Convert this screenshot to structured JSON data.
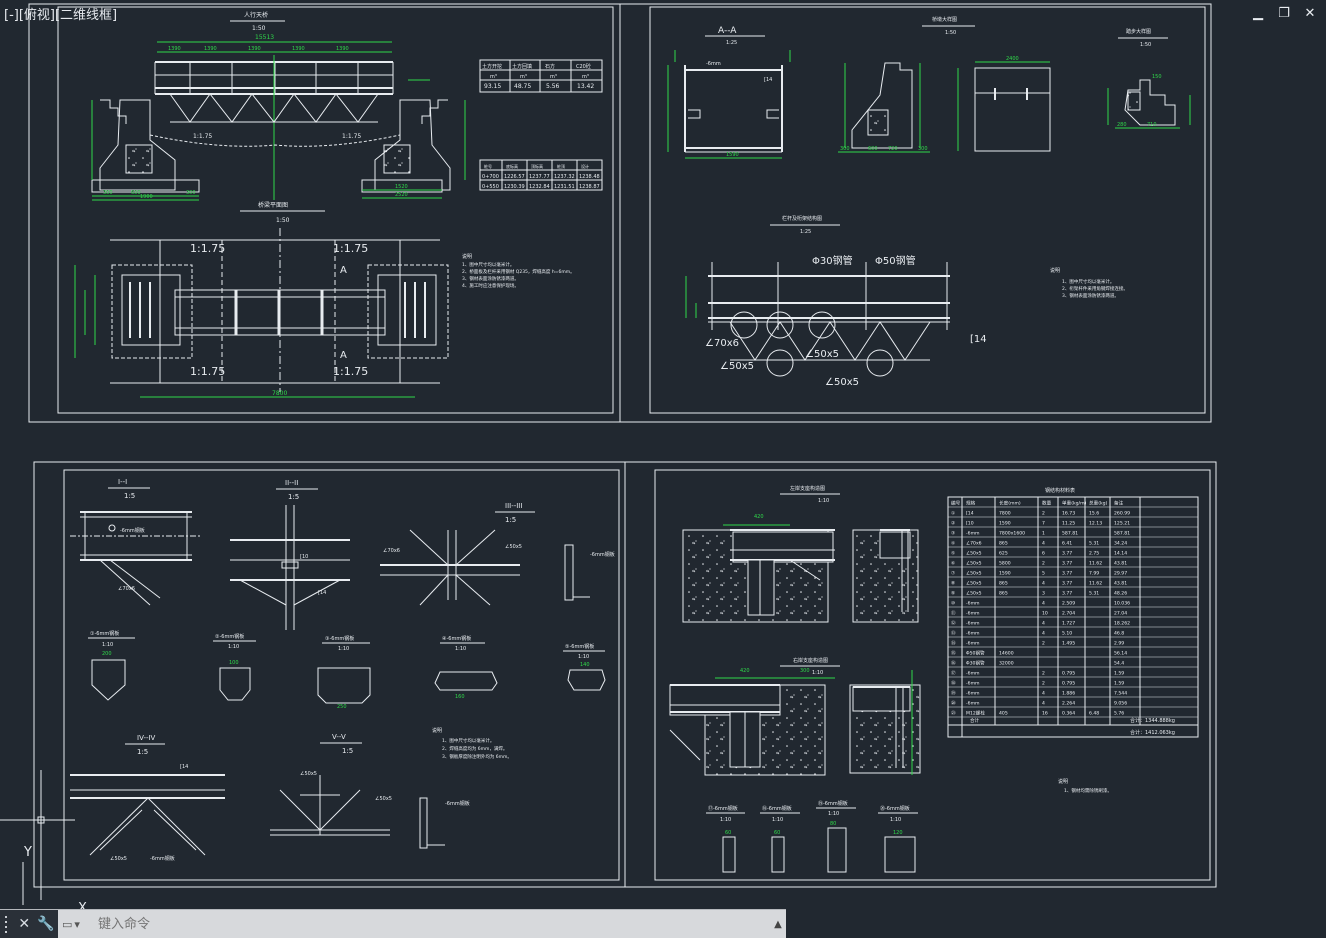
{
  "viewport": {
    "label": "[-][俯视][二维线框]"
  },
  "window_controls": {
    "minimize": "▁",
    "restore": "❐",
    "close": "✕"
  },
  "command": {
    "placeholder": "键入命令"
  },
  "colors": {
    "background": "#212830",
    "line": "#e8ecf0",
    "dimension": "#2fd94a",
    "text": "#dfe4ea"
  },
  "sheet1": {
    "elevation_title": "人行天桥",
    "elevation_scale": "1:50",
    "span_total": "15513",
    "spans": [
      "1390",
      "1390",
      "1390",
      "1390",
      "1390"
    ],
    "plan_title": "桥梁平面图",
    "plan_scale": "1:50",
    "slope_labels": [
      "1:1.75",
      "1:1.75",
      "1:1.75",
      "1:1.75"
    ],
    "section_marks": [
      "A",
      "A"
    ],
    "plan_width": "7800",
    "left_dims": [
      "1900",
      "600",
      "1900"
    ],
    "bottom_dims": [
      "300",
      "600",
      "300"
    ],
    "right_dims": [
      "1520",
      "2520"
    ],
    "qty_table": {
      "header": [
        "土方开挖",
        "土方回填",
        "石方",
        "C20砼"
      ],
      "units": [
        "m³",
        "m³",
        "m³",
        "m³"
      ],
      "values": [
        "93.15",
        "48.75",
        "5.56",
        "13.42"
      ]
    },
    "elev_table": {
      "header": [
        "桩号",
        "底标高",
        "顶标高",
        "桩顶",
        "设计"
      ],
      "rows": [
        [
          "0+700",
          "1226.57",
          "1237.77",
          "1237.32",
          "1238.48"
        ],
        [
          "0+550",
          "1230.39",
          "1232.84",
          "1231.51",
          "1238.87"
        ]
      ]
    },
    "notes_title": "说明",
    "notes": [
      "1、图中尺寸均以毫米计。",
      "2、桥面板及栏杆采用钢材 Q235，焊缝高度 h=6mm。",
      "3、钢材表面涂防锈漆两道。",
      "4、施工时应注意保护现场。"
    ]
  },
  "sheet2": {
    "section_aa": "A--A",
    "section_aa_scale": "1:25",
    "abut_title": "桥墩大样图",
    "abut_scale": "1:50",
    "step_title": "踏步大样图",
    "step_scale": "1:50",
    "truss_title": "栏杆及桁架结构图",
    "truss_scale": "1:25",
    "truss_labels": [
      "Φ30钢管",
      "Φ50钢管",
      "∠70x6",
      "∠50x5",
      "∠50x5",
      "∠50x5",
      "[14"
    ],
    "section_dims": [
      "1590",
      "[14",
      "[14"
    ],
    "abut_dims": [
      "300",
      "600",
      "720",
      "300",
      "2400"
    ],
    "step_dims": [
      "150",
      "280",
      "710"
    ],
    "notes_title": "说明",
    "notes": [
      "1、图中尺寸均以毫米计。",
      "2、桁架杆件采用角钢焊接连接。",
      "3、钢材表面涂防锈漆两道。"
    ]
  },
  "sheet3": {
    "sec1": "I--I",
    "sec1_scale": "1:5",
    "sec2": "II--II",
    "sec2_scale": "1:5",
    "sec3": "III--III",
    "sec3_scale": "1:5",
    "sec4": "IV--IV",
    "sec4_scale": "1:5",
    "sec5": "V--V",
    "sec5_scale": "1:5",
    "plate_scale": "1:10",
    "plate_labels": [
      "①-6mm钢板",
      "②-6mm钢板",
      "③-6mm钢板",
      "④-6mm钢板",
      "⑤-6mm钢板"
    ],
    "plate_dims": [
      "200",
      "100",
      "250",
      "160",
      "140"
    ],
    "member_labels": [
      "∠70x6",
      "∠50x5",
      "[14",
      "-6mm钢板"
    ],
    "notes_title": "说明",
    "notes": [
      "1、图中尺寸均以毫米计。",
      "2、焊缝高度均为 6mm，满焊。",
      "3、钢板厚度除注明外均为 6mm。"
    ]
  },
  "sheet4": {
    "left_bearing_title": "左岸支座构造图",
    "left_bearing_scale": "1:10",
    "right_bearing_title": "右岸支座构造图",
    "right_bearing_scale": "1:10",
    "bearing_dims": [
      "420",
      "300",
      "420",
      "300"
    ],
    "plate_scale": "1:10",
    "small_plates": [
      "⑰-6mm钢板",
      "⑱-6mm钢板",
      "⑲-6mm钢板",
      "⑳-6mm钢板"
    ],
    "small_plate_dims": [
      "60",
      "60",
      "80",
      "120"
    ],
    "table_title": "钢结构材料表",
    "table_header": [
      "编号",
      "规格",
      "长度(mm)",
      "数量",
      "单重(kg/m)",
      "总重(kg)",
      "备注"
    ],
    "table_rows": [
      [
        "①",
        "[14",
        "7800",
        "2",
        "16.73",
        "15.6",
        "260.99"
      ],
      [
        "②",
        "[10",
        "1590",
        "7",
        "11.25",
        "12.13",
        "125.21"
      ],
      [
        "③",
        "-6mm",
        "7800x1600",
        "1",
        "587.81",
        "",
        "587.81"
      ],
      [
        "④",
        "∠70x6",
        "865",
        "4",
        "6.41",
        "5.31",
        "34.24"
      ],
      [
        "⑤",
        "∠50x5",
        "625",
        "6",
        "3.77",
        "2.75",
        "14.14"
      ],
      [
        "⑥",
        "∠50x5",
        "5800",
        "2",
        "3.77",
        "11.62",
        "43.81"
      ],
      [
        "⑦",
        "∠50x5",
        "1590",
        "5",
        "3.77",
        "7.99",
        "29.97"
      ],
      [
        "⑧",
        "∠50x5",
        "865",
        "4",
        "3.77",
        "11.62",
        "43.81"
      ],
      [
        "⑨",
        "∠50x5",
        "865",
        "3",
        "3.77",
        "5.31",
        "48.26"
      ],
      [
        "⑩",
        "-6mm",
        "",
        "4",
        "2.509",
        "",
        "10.036"
      ],
      [
        "⑪",
        "-6mm",
        "",
        "10",
        "2.704",
        "",
        "27.04"
      ],
      [
        "⑫",
        "-6mm",
        "",
        "4",
        "1.727",
        "",
        "18.262"
      ],
      [
        "⑬",
        "-6mm",
        "",
        "4",
        "5.10",
        "",
        "46.8"
      ],
      [
        "⑭",
        "-6mm",
        "",
        "2",
        "1.495",
        "",
        "2.99"
      ],
      [
        "⑮",
        "Φ50钢管",
        "14600",
        "",
        "",
        "",
        "56.14"
      ],
      [
        "⑯",
        "Φ30钢管",
        "32000",
        "",
        "",
        "",
        "54.4"
      ],
      [
        "⑰",
        "-6mm",
        "",
        "2",
        "0.795",
        "",
        "1.59"
      ],
      [
        "⑱",
        "-6mm",
        "",
        "2",
        "0.795",
        "",
        "1.59"
      ],
      [
        "⑲",
        "-6mm",
        "",
        "4",
        "1.886",
        "",
        "7.544"
      ],
      [
        "⑳",
        "-6mm",
        "",
        "4",
        "2.264",
        "",
        "9.056"
      ],
      [
        "㉑",
        "M12螺栓",
        "405",
        "16",
        "0.364",
        "6.48",
        "5.76"
      ]
    ],
    "total1": "合计：1344.888kg",
    "total2": "合计：1412.063kg",
    "notes_title": "说明",
    "notes": [
      "1、钢材均需除锈刷漆。"
    ]
  }
}
